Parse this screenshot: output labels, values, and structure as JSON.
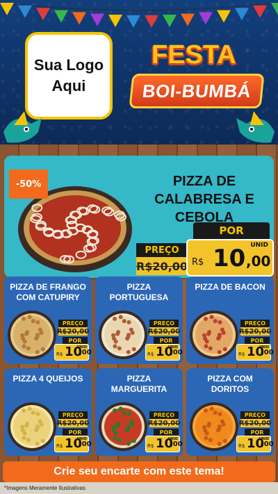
{
  "logo": {
    "text": "Sua Logo\nAqui"
  },
  "festa": {
    "line1": "FESTA",
    "line2": "BOI-BUMBÁ"
  },
  "featured": {
    "discount": "-50%",
    "title": "PIZZA DE\nCALABRESA E\nCEBOLA",
    "preco_label": "PREÇO",
    "preco_value": "R$20,00",
    "por_label": "POR",
    "currency": "R$",
    "por_int": "10",
    "por_dec": ",00",
    "unid": "UNID"
  },
  "cards": [
    {
      "title": "PIZZA DE FRANGO\nCOM CATUPIRY",
      "preco_label": "PREÇO",
      "preco_value": "R$20,00",
      "por_label": "POR",
      "currency": "R$",
      "int": "10",
      "dec": ",00",
      "unid": "UNID",
      "pizza": "chicken"
    },
    {
      "title": "PIZZA\nPORTUGUESA",
      "preco_label": "PREÇO",
      "preco_value": "R$20,00",
      "por_label": "POR",
      "currency": "R$",
      "int": "10",
      "dec": ",00",
      "unid": "UNID",
      "pizza": "portuguesa"
    },
    {
      "title": "PIZZA DE BACON",
      "preco_label": "PREÇO",
      "preco_value": "R$20,00",
      "por_label": "POR",
      "currency": "R$",
      "int": "10",
      "dec": ",00",
      "unid": "UNID",
      "pizza": "bacon"
    },
    {
      "title": "PIZZA 4 QUEIJOS",
      "preco_label": "PREÇO",
      "preco_value": "R$20,00",
      "por_label": "POR",
      "currency": "R$",
      "int": "10",
      "dec": ",00",
      "unid": "UNID",
      "pizza": "cheese"
    },
    {
      "title": "PIZZA\nMARGUERITA",
      "preco_label": "PREÇO",
      "preco_value": "R$20,00",
      "por_label": "POR",
      "currency": "R$",
      "int": "10",
      "dec": ",00",
      "unid": "UNID",
      "pizza": "margherita"
    },
    {
      "title": "PIZZA COM\nDORITOS",
      "preco_label": "PREÇO",
      "preco_value": "R$20,00",
      "por_label": "POR",
      "currency": "R$",
      "int": "10",
      "dec": ",00",
      "unid": "UNID",
      "pizza": "doritos"
    }
  ],
  "cta": {
    "label": "Crie seu encarte com este tema!"
  },
  "footnote": {
    "text": "*Imagens Meramente Ilustrativas"
  },
  "colors": {
    "header_blue": "#123f7c",
    "teal": "#35b8c8",
    "card_blue": "#2c67b6",
    "orange": "#f26a1c",
    "gold": "#f3c42a"
  }
}
